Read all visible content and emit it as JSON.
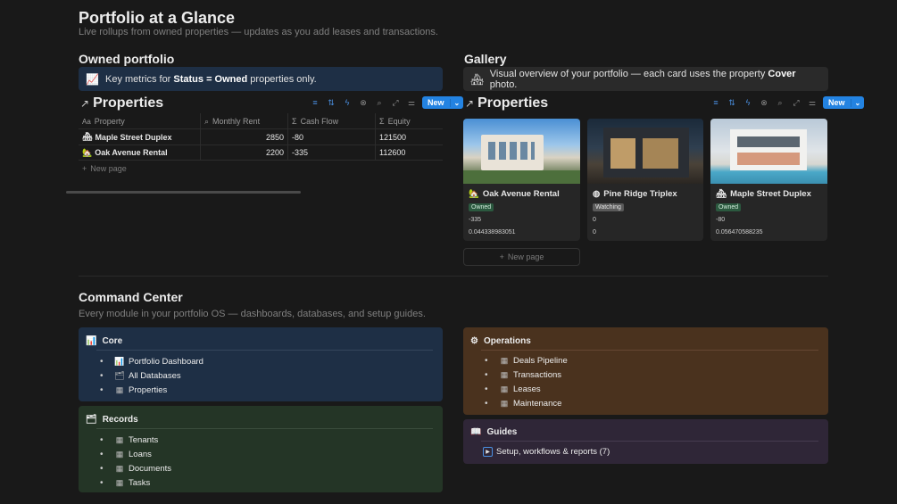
{
  "page": {
    "title": "Portfolio at a Glance",
    "subtitle": "Live rollups from owned properties — updates as you add leases and transactions."
  },
  "owned": {
    "heading": "Owned portfolio",
    "callout_icon": "chart-increasing-icon",
    "callout_pre": "Key metrics for ",
    "callout_bold": "Status = Owned",
    "callout_post": " properties only.",
    "db_title": "Properties",
    "new_label": "New",
    "columns": [
      "Property",
      "Monthly Rent",
      "Cash Flow",
      "Equity"
    ],
    "rows": [
      {
        "name": "Maple Street Duplex",
        "rent": "2850",
        "cash_flow": "-80",
        "equity": "121500"
      },
      {
        "name": "Oak Avenue Rental",
        "rent": "2200",
        "cash_flow": "-335",
        "equity": "112600"
      }
    ],
    "new_page": "New page"
  },
  "gallery": {
    "heading": "Gallery",
    "callout_pre": "Visual overview of your portfolio — each card uses the property ",
    "callout_bold": "Cover",
    "callout_post": " photo.",
    "db_title": "Properties",
    "new_label": "New",
    "cards": [
      {
        "name": "Oak Avenue Rental",
        "status": "Owned",
        "status_color": "#2b593f",
        "cash_flow": "-335",
        "ratio": "0.044338983051"
      },
      {
        "name": "Pine Ridge Triplex",
        "status": "Watching",
        "status_color": "#5a5a5a",
        "cash_flow": "0",
        "ratio": "0"
      },
      {
        "name": "Maple Street Duplex",
        "status": "Owned",
        "status_color": "#2b593f",
        "cash_flow": "-80",
        "ratio": "0.056470588235"
      }
    ],
    "new_page": "New page"
  },
  "command": {
    "title": "Command Center",
    "subtitle": "Every module in your portfolio OS — dashboards, databases, and setup guides.",
    "core": {
      "title": "Core",
      "color": "#1e2f45",
      "items": [
        "Portfolio Dashboard",
        "All Databases",
        "Properties"
      ]
    },
    "records": {
      "title": "Records",
      "color": "#243526",
      "items": [
        "Tenants",
        "Loans",
        "Documents",
        "Tasks"
      ]
    },
    "operations": {
      "title": "Operations",
      "color": "#4a321e",
      "items": [
        "Deals Pipeline",
        "Transactions",
        "Leases",
        "Maintenance"
      ]
    },
    "guides": {
      "title": "Guides",
      "color": "#2f2637",
      "toggle_label": "Setup, workflows & reports (7)"
    }
  }
}
